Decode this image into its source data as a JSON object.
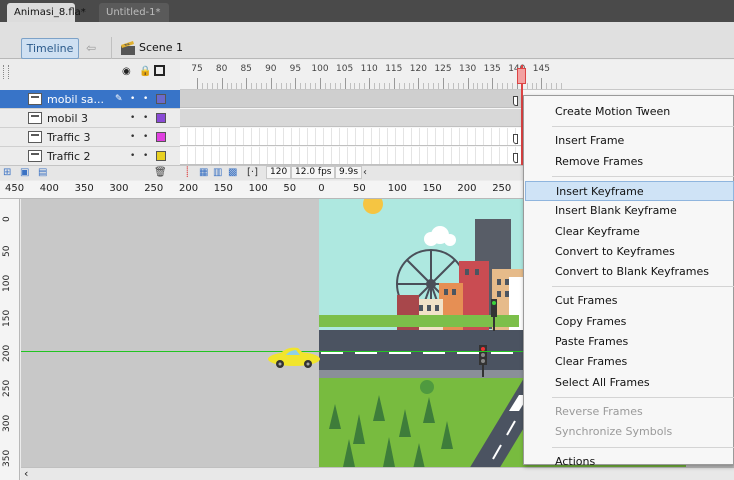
{
  "document_tabs": [
    {
      "label": "Animasi_8.fla*"
    },
    {
      "label": "Untitled-1*"
    }
  ],
  "nav": {
    "timeline_label": "Timeline",
    "scene_label": "Scene 1"
  },
  "timeline": {
    "frame_numbers": [
      "75",
      "80",
      "85",
      "90",
      "95",
      "100",
      "105",
      "110",
      "115",
      "120",
      "125",
      "130",
      "135",
      "140",
      "145"
    ],
    "layers": [
      {
        "name": "mobil sa...",
        "color": "#6a6acc",
        "selected": true
      },
      {
        "name": "mobil 3",
        "color": "#8a4bd6",
        "selected": false
      },
      {
        "name": "Traffic 3",
        "color": "#e040e0",
        "selected": false
      },
      {
        "name": "Traffic 2",
        "color": "#e8d020",
        "selected": false
      }
    ],
    "current_frame": "120",
    "fps": "12.0 fps",
    "time": "9.9s"
  },
  "stage": {
    "h_ruler": [
      "450",
      "400",
      "350",
      "300",
      "250",
      "200",
      "150",
      "100",
      "50",
      "0",
      "50",
      "100",
      "150",
      "200",
      "250"
    ],
    "v_ruler": [
      "0",
      "50",
      "100",
      "150",
      "200",
      "250",
      "300",
      "350"
    ]
  },
  "context_menu": {
    "groups": [
      [
        "Create Motion Tween"
      ],
      [
        "Insert Frame",
        "Remove Frames"
      ],
      [
        "Insert Keyframe",
        "Insert Blank Keyframe",
        "Clear Keyframe",
        "Convert to Keyframes",
        "Convert to Blank Keyframes"
      ],
      [
        "Cut Frames",
        "Copy Frames",
        "Paste Frames",
        "Clear Frames",
        "Select All Frames"
      ],
      [
        "Reverse Frames",
        "Synchronize Symbols"
      ],
      [
        "Actions"
      ]
    ],
    "highlighted": "Insert Keyframe",
    "disabled": [
      "Reverse Frames",
      "Synchronize Symbols"
    ]
  },
  "colors": {
    "selection": "#3874c8",
    "playhead": "#d44444",
    "guide": "#22c422",
    "stage_sky": "#aee8e0"
  }
}
